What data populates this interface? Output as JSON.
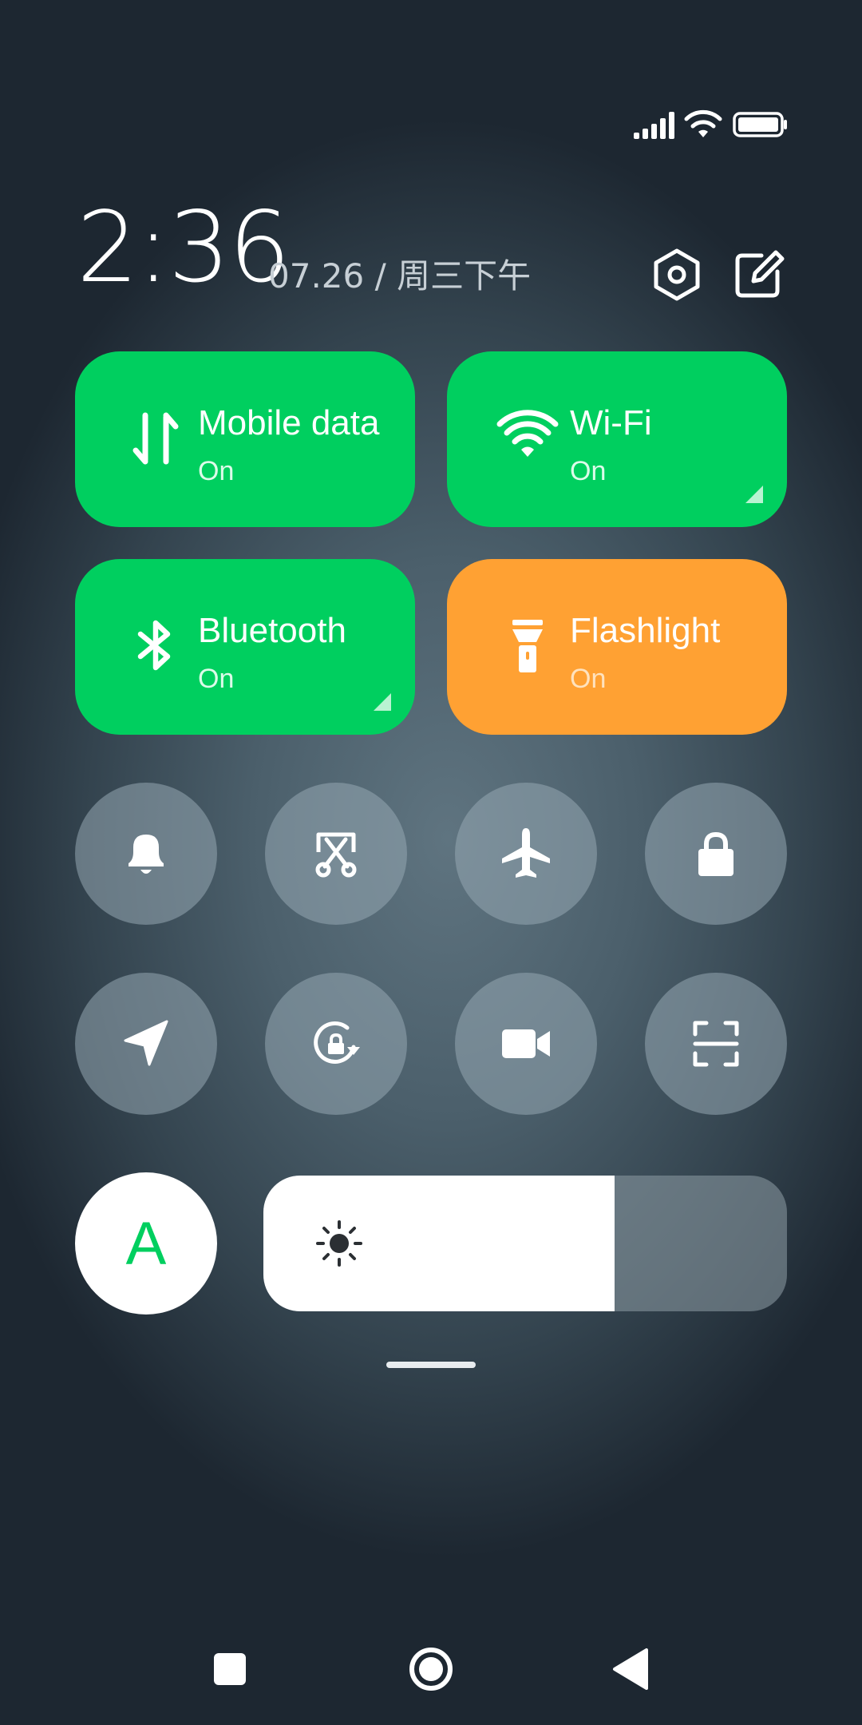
{
  "header": {
    "time": "2:36",
    "date": "07.26 / 周三下午"
  },
  "tiles": [
    {
      "title": "Mobile data",
      "status": "On",
      "color": "#00cf5f",
      "icon": "mobile-data-icon"
    },
    {
      "title": "Wi-Fi",
      "status": "On",
      "color": "#00cf5f",
      "icon": "wifi-icon"
    },
    {
      "title": "Bluetooth",
      "status": "On",
      "color": "#00cf5f",
      "icon": "bluetooth-icon"
    },
    {
      "title": "Flashlight",
      "status": "On",
      "color": "#ffa133",
      "icon": "flashlight-icon"
    }
  ],
  "toggles": [
    "bell-icon",
    "screenshot-icon",
    "airplane-icon",
    "lock-icon",
    "location-icon",
    "rotation-lock-icon",
    "video-camera-icon",
    "scan-icon"
  ],
  "brightness": {
    "auto_label": "A",
    "level_fraction": 0.67
  },
  "colors": {
    "accent_green": "#00cf5f",
    "accent_orange": "#ffa133"
  }
}
